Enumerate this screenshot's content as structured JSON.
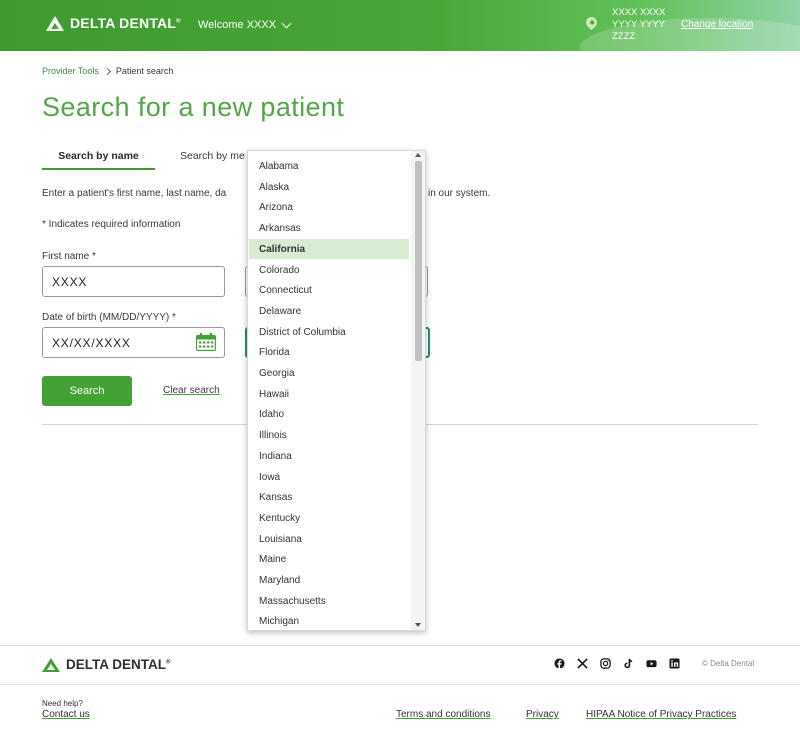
{
  "header": {
    "brand": "DELTA DENTAL",
    "welcome": "Welcome XXXX",
    "address_lines": [
      "XXXX XXXX",
      "YYYY YYYY",
      "ZZZZ"
    ],
    "change_location": "Change location"
  },
  "breadcrumb": {
    "parent": "Provider Tools",
    "current": "Patient search"
  },
  "page_title": "Search for a new patient",
  "tabs": [
    {
      "label": "Search by name",
      "active": true
    },
    {
      "label": "Search by me"
    }
  ],
  "instructions": {
    "visible_start": "Enter a patient's first name, last name, da",
    "visible_end": "in our system."
  },
  "required_note": "* Indicates required information",
  "form": {
    "first_name_label": "First name *",
    "first_name_value": "XXXX",
    "dob_label": "Date of birth (MM/DD/YYYY) *",
    "dob_value": "XX/XX/XXXX",
    "search_button": "Search",
    "clear_search": "Clear search"
  },
  "state_dropdown": {
    "selected": "California",
    "options": [
      "Alabama",
      "Alaska",
      "Arizona",
      "Arkansas",
      "California",
      "Colorado",
      "Connecticut",
      "Delaware",
      "District of Columbia",
      "Florida",
      "Georgia",
      "Hawaii",
      "Idaho",
      "Illinois",
      "Indiana",
      "Iowa",
      "Kansas",
      "Kentucky",
      "Louisiana",
      "Maine",
      "Maryland",
      "Massachusetts",
      "Michigan"
    ]
  },
  "footer": {
    "brand": "DELTA DENTAL",
    "social_icons": [
      "facebook-icon",
      "x-icon",
      "instagram-icon",
      "tiktok-icon",
      "youtube-icon",
      "linkedin-icon"
    ],
    "copyright": "© Delta Dental",
    "need_help": "Need help?",
    "contact_us": "Contact us",
    "terms": "Terms and conditions",
    "privacy": "Privacy",
    "hipaa": "HIPAA Notice of Privacy Practices"
  },
  "colors": {
    "brand_green": "#43a234",
    "title_green": "#54a64a",
    "selected_bg": "#d7ecd2"
  }
}
